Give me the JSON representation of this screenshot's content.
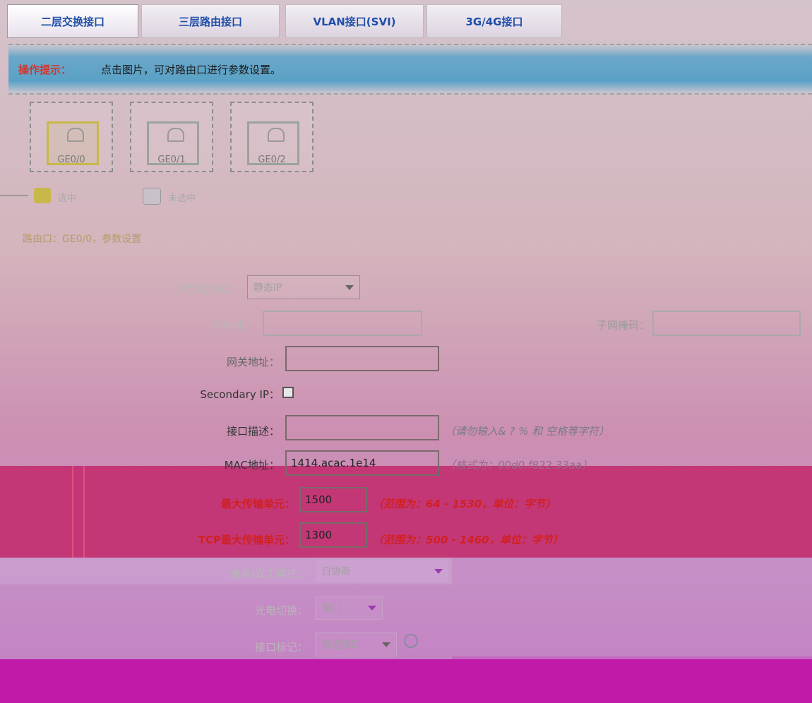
{
  "tabs": [
    {
      "label": "二层交换接口"
    },
    {
      "label": "三层路由接口"
    },
    {
      "label": "VLAN接口(SVI)"
    },
    {
      "label": "3G/4G接口"
    }
  ],
  "tip": {
    "label": "操作提示：",
    "text": "点击图片，可对路由口进行参数设置。"
  },
  "ports": [
    {
      "label": "GE0/0",
      "selected": true
    },
    {
      "label": "GE0/1",
      "selected": false
    },
    {
      "label": "GE0/2",
      "selected": false
    }
  ],
  "legend": [
    {
      "label": "选中",
      "color": "#c8b84a"
    },
    {
      "label": "未选中",
      "color": "#c9c1c9"
    }
  ],
  "section_title": "路由口：GE0/0，参数设置",
  "form": {
    "mode_label": "IP分配方式：",
    "mode_value": "静态IP",
    "ip_label": "IP地址：",
    "mask_label": "子网掩码：",
    "gateway_label": "网关地址：",
    "secondary_label": "Secondary IP：",
    "desc_label": "接口描述：",
    "desc_hint": "（请勿输入& ? % 和 空格等字符）",
    "mac_label": "MAC地址：",
    "mac_value": "1414.acac.1e14",
    "mac_hint": "（格式为：00d0.f822.33aa）",
    "mtu_label": "最大传输单元：",
    "mtu_value": "1500",
    "mtu_hint": "（范围为：64 - 1530，单位：字节）",
    "tcp_mtu_label": "TCP最大传输单元：",
    "tcp_mtu_value": "1300",
    "tcp_mtu_hint": "（范围为：500 - 1460，单位：字节）",
    "speed_label": "速率/双工模式：",
    "speed_value": "自协商",
    "medium_label": "光电切换：",
    "medium_value": "电口",
    "link_label": "接口标记：",
    "link_value": "普通接口"
  }
}
